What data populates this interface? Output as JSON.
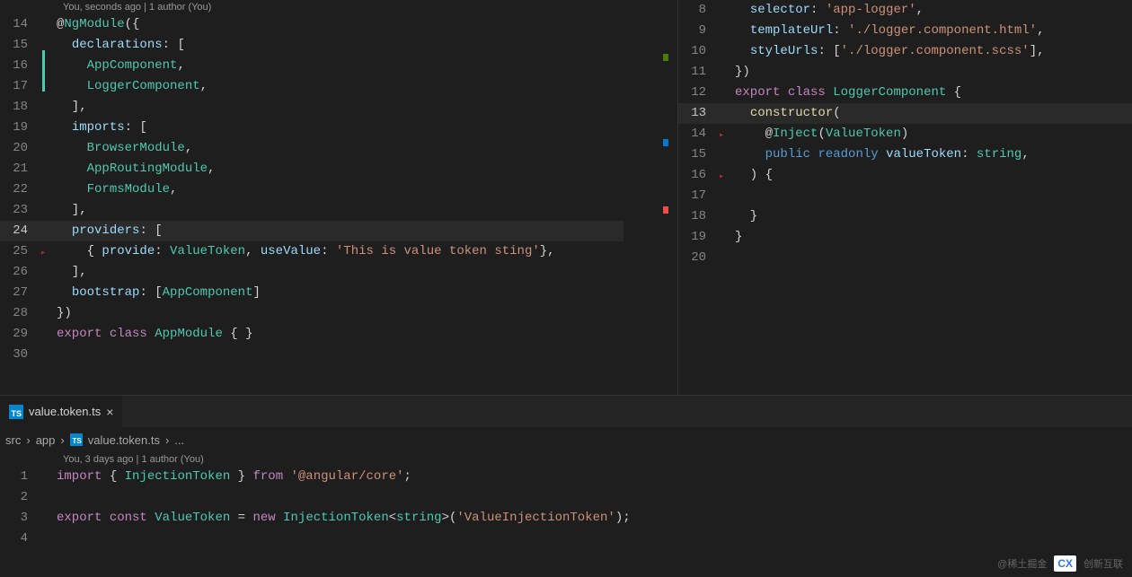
{
  "leftPane": {
    "codelens": "You, seconds ago | 1 author (You)",
    "lines": [
      {
        "n": "14",
        "bp": "",
        "highlight": false,
        "tokens": [
          {
            "t": "@",
            "c": "tok-at"
          },
          {
            "t": "NgModule",
            "c": "tok-dec"
          },
          {
            "t": "({",
            "c": "tok-pun"
          }
        ]
      },
      {
        "n": "15",
        "bp": "",
        "highlight": false,
        "tokens": [
          {
            "t": "  ",
            "c": ""
          },
          {
            "t": "declarations",
            "c": "tok-prop"
          },
          {
            "t": ": [",
            "c": "tok-pun"
          }
        ]
      },
      {
        "n": "16",
        "bp": "",
        "highlight": false,
        "tokens": [
          {
            "t": "    ",
            "c": ""
          },
          {
            "t": "AppComponent",
            "c": "tok-type"
          },
          {
            "t": ",",
            "c": "tok-pun"
          }
        ]
      },
      {
        "n": "17",
        "bp": "",
        "highlight": false,
        "tokens": [
          {
            "t": "    ",
            "c": ""
          },
          {
            "t": "LoggerComponent",
            "c": "tok-type"
          },
          {
            "t": ",",
            "c": "tok-pun"
          }
        ]
      },
      {
        "n": "18",
        "bp": "",
        "highlight": false,
        "tokens": [
          {
            "t": "  ],",
            "c": "tok-pun"
          }
        ]
      },
      {
        "n": "19",
        "bp": "",
        "highlight": false,
        "tokens": [
          {
            "t": "  ",
            "c": ""
          },
          {
            "t": "imports",
            "c": "tok-prop"
          },
          {
            "t": ": [",
            "c": "tok-pun"
          }
        ]
      },
      {
        "n": "20",
        "bp": "",
        "highlight": false,
        "tokens": [
          {
            "t": "    ",
            "c": ""
          },
          {
            "t": "BrowserModule",
            "c": "tok-type"
          },
          {
            "t": ",",
            "c": "tok-pun"
          }
        ]
      },
      {
        "n": "21",
        "bp": "",
        "highlight": false,
        "tokens": [
          {
            "t": "    ",
            "c": ""
          },
          {
            "t": "AppRoutingModule",
            "c": "tok-type"
          },
          {
            "t": ",",
            "c": "tok-pun"
          }
        ]
      },
      {
        "n": "22",
        "bp": "",
        "highlight": false,
        "tokens": [
          {
            "t": "    ",
            "c": ""
          },
          {
            "t": "FormsModule",
            "c": "tok-type"
          },
          {
            "t": ",",
            "c": "tok-pun"
          }
        ]
      },
      {
        "n": "23",
        "bp": "",
        "highlight": false,
        "tokens": [
          {
            "t": "  ],",
            "c": "tok-pun"
          }
        ]
      },
      {
        "n": "24",
        "bp": "",
        "highlight": true,
        "active": true,
        "tokens": [
          {
            "t": "  ",
            "c": ""
          },
          {
            "t": "providers",
            "c": "tok-prop"
          },
          {
            "t": ": [",
            "c": "tok-pun"
          }
        ]
      },
      {
        "n": "25",
        "bp": "▸",
        "highlight": false,
        "tokens": [
          {
            "t": "    { ",
            "c": "tok-pun"
          },
          {
            "t": "provide",
            "c": "tok-prop"
          },
          {
            "t": ": ",
            "c": "tok-pun"
          },
          {
            "t": "ValueToken",
            "c": "tok-type"
          },
          {
            "t": ", ",
            "c": "tok-pun"
          },
          {
            "t": "useValue",
            "c": "tok-prop"
          },
          {
            "t": ": ",
            "c": "tok-pun"
          },
          {
            "t": "'This is value token sting'",
            "c": "tok-str"
          },
          {
            "t": "},",
            "c": "tok-pun"
          }
        ]
      },
      {
        "n": "26",
        "bp": "",
        "highlight": false,
        "tokens": [
          {
            "t": "  ],",
            "c": "tok-pun"
          }
        ]
      },
      {
        "n": "27",
        "bp": "",
        "highlight": false,
        "tokens": [
          {
            "t": "  ",
            "c": ""
          },
          {
            "t": "bootstrap",
            "c": "tok-prop"
          },
          {
            "t": ": [",
            "c": "tok-pun"
          },
          {
            "t": "AppComponent",
            "c": "tok-type"
          },
          {
            "t": "]",
            "c": "tok-pun"
          }
        ]
      },
      {
        "n": "28",
        "bp": "",
        "highlight": false,
        "tokens": [
          {
            "t": "})",
            "c": "tok-pun"
          }
        ]
      },
      {
        "n": "29",
        "bp": "",
        "highlight": false,
        "tokens": [
          {
            "t": "export",
            "c": "tok-key"
          },
          {
            "t": " ",
            "c": ""
          },
          {
            "t": "class",
            "c": "tok-key"
          },
          {
            "t": " ",
            "c": ""
          },
          {
            "t": "AppModule",
            "c": "tok-type"
          },
          {
            "t": " { }",
            "c": "tok-pun"
          }
        ]
      },
      {
        "n": "30",
        "bp": "",
        "highlight": false,
        "tokens": []
      }
    ]
  },
  "rightPane": {
    "lines": [
      {
        "n": "8",
        "bp": "",
        "highlight": false,
        "tokens": [
          {
            "t": "  ",
            "c": ""
          },
          {
            "t": "selector",
            "c": "tok-prop"
          },
          {
            "t": ": ",
            "c": "tok-pun"
          },
          {
            "t": "'app-logger'",
            "c": "tok-str"
          },
          {
            "t": ",",
            "c": "tok-pun"
          }
        ]
      },
      {
        "n": "9",
        "bp": "",
        "highlight": false,
        "tokens": [
          {
            "t": "  ",
            "c": ""
          },
          {
            "t": "templateUrl",
            "c": "tok-prop"
          },
          {
            "t": ": ",
            "c": "tok-pun"
          },
          {
            "t": "'./logger.component.html'",
            "c": "tok-str"
          },
          {
            "t": ",",
            "c": "tok-pun"
          }
        ]
      },
      {
        "n": "10",
        "bp": "",
        "highlight": false,
        "tokens": [
          {
            "t": "  ",
            "c": ""
          },
          {
            "t": "styleUrls",
            "c": "tok-prop"
          },
          {
            "t": ": [",
            "c": "tok-pun"
          },
          {
            "t": "'./logger.component.scss'",
            "c": "tok-str"
          },
          {
            "t": "],",
            "c": "tok-pun"
          }
        ]
      },
      {
        "n": "11",
        "bp": "",
        "highlight": false,
        "tokens": [
          {
            "t": "})",
            "c": "tok-pun"
          }
        ]
      },
      {
        "n": "12",
        "bp": "",
        "highlight": false,
        "tokens": [
          {
            "t": "export",
            "c": "tok-key"
          },
          {
            "t": " ",
            "c": ""
          },
          {
            "t": "class",
            "c": "tok-key"
          },
          {
            "t": " ",
            "c": ""
          },
          {
            "t": "LoggerComponent",
            "c": "tok-type"
          },
          {
            "t": " {",
            "c": "tok-pun"
          }
        ]
      },
      {
        "n": "13",
        "bp": "",
        "highlight": true,
        "active": true,
        "tokens": [
          {
            "t": "  ",
            "c": ""
          },
          {
            "t": "constructor",
            "c": "tok-fn"
          },
          {
            "t": "(",
            "c": "tok-pun"
          }
        ]
      },
      {
        "n": "14",
        "bp": "▸",
        "highlight": false,
        "tokens": [
          {
            "t": "    @",
            "c": "tok-pun"
          },
          {
            "t": "Inject",
            "c": "tok-dec"
          },
          {
            "t": "(",
            "c": "tok-pun"
          },
          {
            "t": "ValueToken",
            "c": "tok-type"
          },
          {
            "t": ")",
            "c": "tok-pun"
          }
        ]
      },
      {
        "n": "15",
        "bp": "",
        "highlight": false,
        "tokens": [
          {
            "t": "    ",
            "c": ""
          },
          {
            "t": "public",
            "c": "tok-mod"
          },
          {
            "t": " ",
            "c": ""
          },
          {
            "t": "readonly",
            "c": "tok-mod"
          },
          {
            "t": " ",
            "c": ""
          },
          {
            "t": "valueToken",
            "c": "tok-prop"
          },
          {
            "t": ": ",
            "c": "tok-pun"
          },
          {
            "t": "string",
            "c": "tok-type"
          },
          {
            "t": ",",
            "c": "tok-pun"
          }
        ]
      },
      {
        "n": "16",
        "bp": "▸",
        "highlight": false,
        "tokens": [
          {
            "t": "  ) {",
            "c": "tok-pun"
          }
        ]
      },
      {
        "n": "17",
        "bp": "",
        "highlight": false,
        "tokens": []
      },
      {
        "n": "18",
        "bp": "",
        "highlight": false,
        "tokens": [
          {
            "t": "  }",
            "c": "tok-pun"
          }
        ]
      },
      {
        "n": "19",
        "bp": "",
        "highlight": false,
        "tokens": [
          {
            "t": "}",
            "c": "tok-pun"
          }
        ]
      },
      {
        "n": "20",
        "bp": "",
        "highlight": false,
        "tokens": []
      }
    ]
  },
  "bottomPane": {
    "tab": {
      "icon": "TS",
      "label": "value.token.ts"
    },
    "breadcrumb": [
      "src",
      "app",
      "value.token.ts",
      "..."
    ],
    "codelens": "You, 3 days ago | 1 author (You)",
    "lines": [
      {
        "n": "1",
        "bp": "",
        "tokens": [
          {
            "t": "import",
            "c": "tok-key"
          },
          {
            "t": " { ",
            "c": "tok-pun"
          },
          {
            "t": "InjectionToken",
            "c": "tok-type"
          },
          {
            "t": " } ",
            "c": "tok-pun"
          },
          {
            "t": "from",
            "c": "tok-key"
          },
          {
            "t": " ",
            "c": ""
          },
          {
            "t": "'@angular/core'",
            "c": "tok-str"
          },
          {
            "t": ";",
            "c": "tok-pun"
          }
        ]
      },
      {
        "n": "2",
        "bp": "",
        "tokens": []
      },
      {
        "n": "3",
        "bp": "",
        "tokens": [
          {
            "t": "export",
            "c": "tok-key"
          },
          {
            "t": " ",
            "c": ""
          },
          {
            "t": "const",
            "c": "tok-key"
          },
          {
            "t": " ",
            "c": ""
          },
          {
            "t": "ValueToken",
            "c": "tok-type"
          },
          {
            "t": " = ",
            "c": "tok-pun"
          },
          {
            "t": "new",
            "c": "tok-key"
          },
          {
            "t": " ",
            "c": ""
          },
          {
            "t": "InjectionToken",
            "c": "tok-type"
          },
          {
            "t": "<",
            "c": "tok-pun"
          },
          {
            "t": "string",
            "c": "tok-type"
          },
          {
            "t": ">(",
            "c": "tok-pun"
          },
          {
            "t": "'ValueInjectionToken'",
            "c": "tok-str"
          },
          {
            "t": ");",
            "c": "tok-pun"
          }
        ]
      },
      {
        "n": "4",
        "bp": "",
        "tokens": []
      }
    ]
  },
  "watermark": {
    "text1": "@稀土掘金",
    "text2": "创新互联"
  }
}
